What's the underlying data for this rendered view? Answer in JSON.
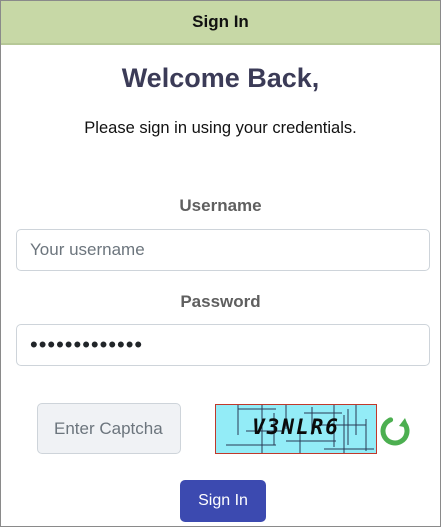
{
  "header": {
    "title": "Sign In",
    "background_color": "#c7d8a6"
  },
  "welcome": {
    "heading": "Welcome Back,",
    "subtitle": "Please sign in using your credentials."
  },
  "form": {
    "username": {
      "label": "Username",
      "placeholder": "Your username",
      "value": ""
    },
    "password": {
      "label": "Password",
      "value": "•••••••••••••"
    },
    "captcha": {
      "placeholder": "Enter Captcha",
      "value": "",
      "image_text": "V3NLR6",
      "image_background_color": "#93ecf7",
      "refresh_icon": "refresh-icon",
      "refresh_icon_color": "#4caf50"
    },
    "submit_label": "Sign In",
    "submit_color": "#3c4ab0"
  }
}
